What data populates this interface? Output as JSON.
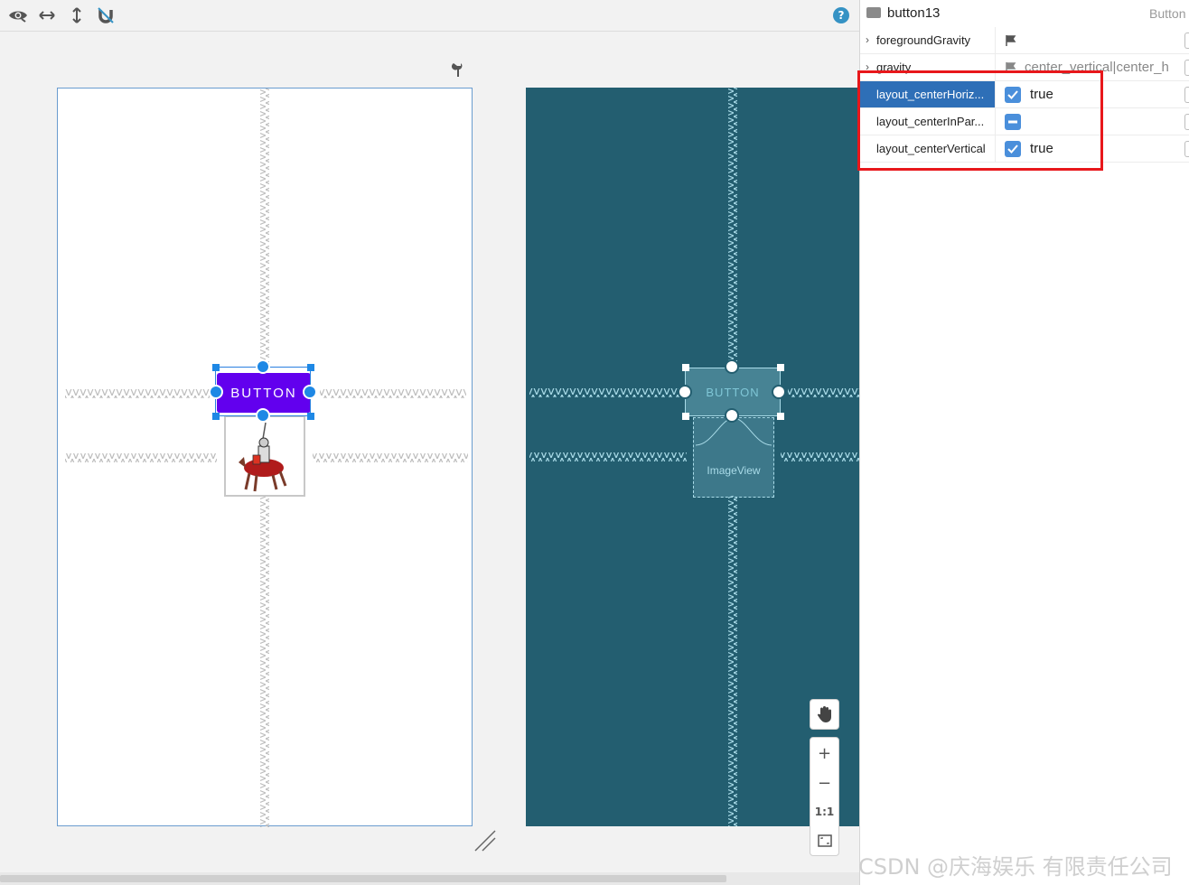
{
  "toolbar": {
    "icons": [
      "eye-icon",
      "horizontal-arrows-icon",
      "vertical-arrows-icon",
      "magnet-off-icon"
    ],
    "help_label": "?"
  },
  "design": {
    "button_label": "BUTTON"
  },
  "blueprint": {
    "button_label": "BUTTON",
    "imageview_label": "ImageView"
  },
  "zoom": {
    "zoom_in": "+",
    "zoom_out": "−",
    "actual_size": "1:1"
  },
  "panel": {
    "component_name": "button13",
    "component_type": "Button",
    "rows": [
      {
        "name": "foregroundGravity",
        "value": ""
      },
      {
        "name": "gravity",
        "value": "center_vertical|center_h"
      },
      {
        "name": "layout_centerHoriz...",
        "value": "true"
      },
      {
        "name": "layout_centerInPar...",
        "value": ""
      },
      {
        "name": "layout_centerVertical",
        "value": "true"
      }
    ]
  },
  "watermark": "CSDN @庆海娱乐 有限责任公司",
  "colors": {
    "accent": "#6200ee",
    "blueprint": "#235e70",
    "selection": "#1e88e5",
    "highlight": "#e8171b"
  }
}
